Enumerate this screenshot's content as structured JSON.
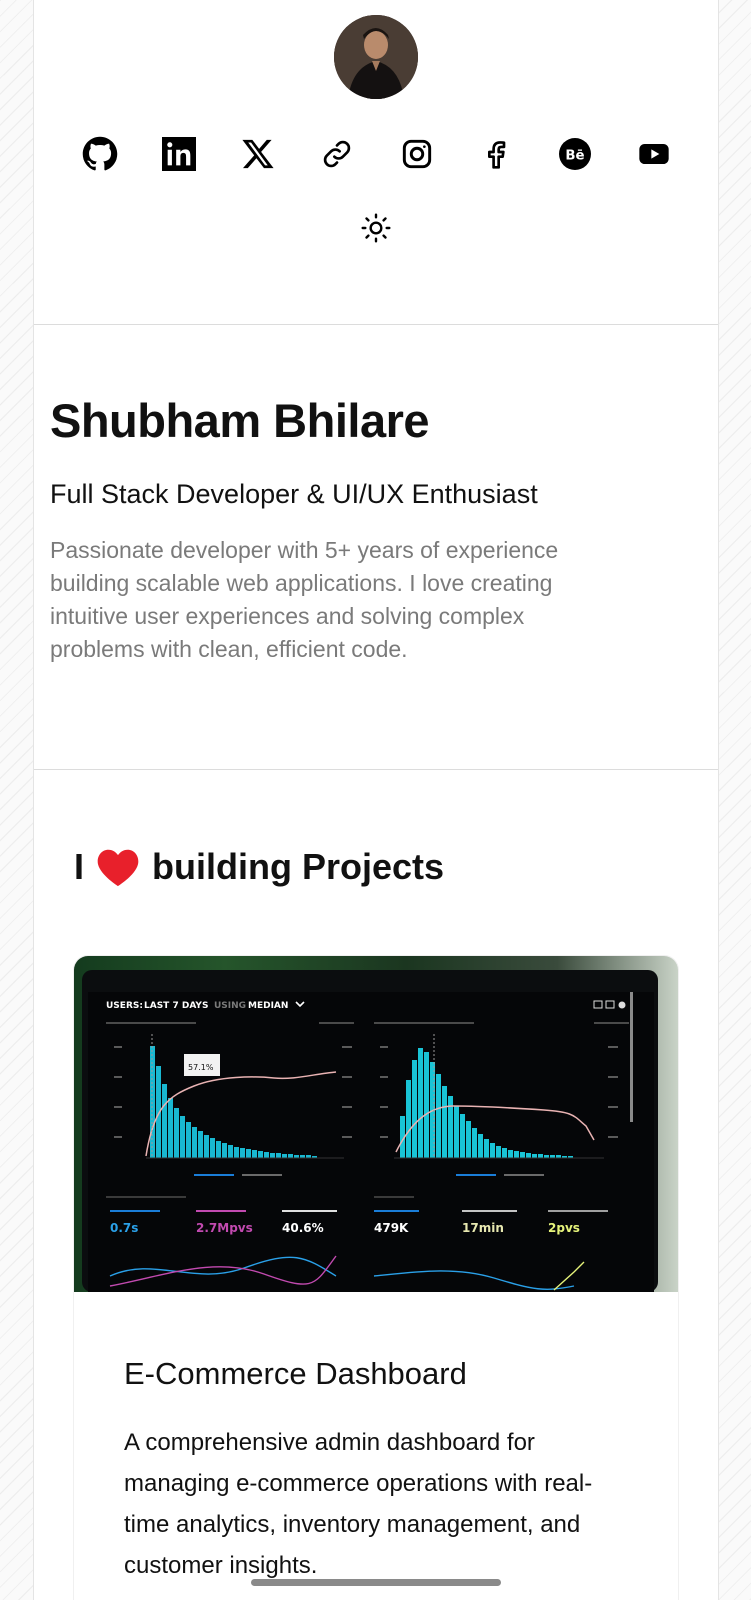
{
  "social": [
    {
      "icon": "github-icon",
      "name": "GitHub"
    },
    {
      "icon": "linkedin-icon",
      "name": "LinkedIn"
    },
    {
      "icon": "x-icon",
      "name": "X"
    },
    {
      "icon": "link-icon",
      "name": "Website"
    },
    {
      "icon": "instagram-icon",
      "name": "Instagram"
    },
    {
      "icon": "facebook-icon",
      "name": "Facebook"
    },
    {
      "icon": "behance-icon",
      "name": "Behance"
    },
    {
      "icon": "youtube-icon",
      "name": "YouTube"
    }
  ],
  "theme_toggle": {
    "icon": "sun-icon"
  },
  "profile": {
    "name": "Shubham Bhilare",
    "role": "Full Stack Developer & UI/UX Enthusiast",
    "bio": "Passionate developer with 5+ years of experience building scalable web applications. I love creating intuitive user experiences and solving complex problems with clean, efficient code."
  },
  "projects": {
    "heading_prefix": "I",
    "heading_icon": "heart-icon",
    "heading_suffix": "building Projects",
    "items": [
      {
        "title": "E-Commerce Dashboard",
        "description": "A comprehensive admin dashboard for managing e-commerce operations with real-time analytics, inventory management, and customer insights.",
        "image": {
          "header_prefix": "USERS:",
          "header_mid": "LAST 7 DAYS",
          "header_using": "USING",
          "header_median": "MEDIAN",
          "tooltip_value": "57.1%",
          "metric_1_value": "0.7s",
          "metric_2_value": "2.7Mpvs",
          "metric_3_value": "40.6%",
          "metric_4_value": "479K",
          "metric_5_value": "17min",
          "metric_6_value": "2pvs"
        }
      }
    ]
  },
  "colors": {
    "heart": "#e8202b",
    "bio_text": "#7a7a7a",
    "chart_cyan": "#21c6d8",
    "chart_pink": "#d84aa8"
  }
}
